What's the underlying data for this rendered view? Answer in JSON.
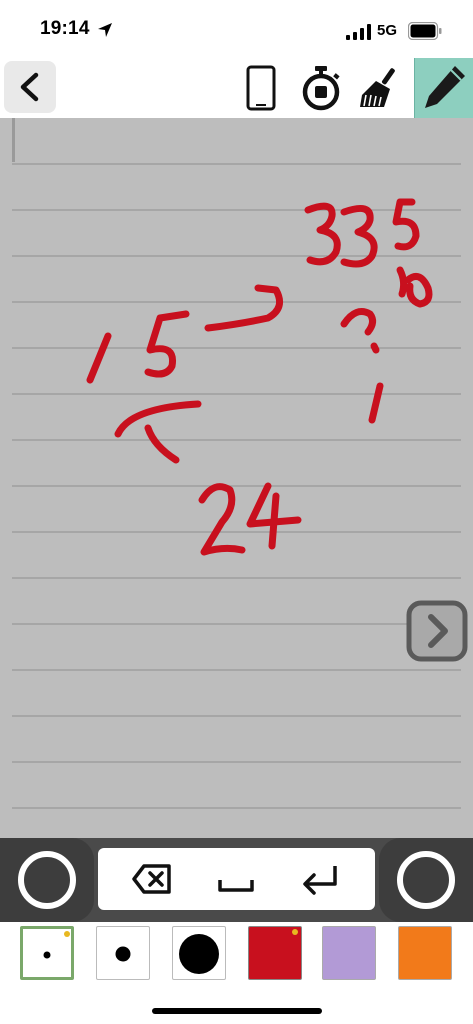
{
  "status_bar": {
    "time": "19:14",
    "network": "5G"
  },
  "toolbar": {
    "back_icon": "chevron-left-icon",
    "phone_icon": "phone-icon",
    "timer_icon": "stopwatch-icon",
    "clear_icon": "broom-icon",
    "pencil_icon": "pencil-icon",
    "pencil_active_color": "#8dcfbf"
  },
  "canvas": {
    "background": "#bdbdbd",
    "ink_color": "#c8101e",
    "handwriting": [
      "15",
      "33",
      "5",
      "%",
      "24"
    ]
  },
  "keys": {
    "backspace_icon": "backspace-icon",
    "space_icon": "space-icon",
    "enter_icon": "return-icon"
  },
  "palette": {
    "pen_sizes": [
      "small",
      "medium",
      "large"
    ],
    "colors": [
      "#c8101e",
      "#b29ad6",
      "#f27a1a"
    ]
  }
}
